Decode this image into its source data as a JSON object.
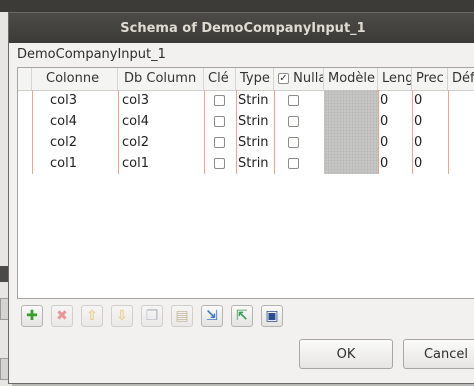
{
  "window": {
    "title": "Schema of DemoCompanyInput_1"
  },
  "schema": {
    "name": "DemoCompanyInput_1"
  },
  "table": {
    "columns": [
      "Colonne",
      "Db Column",
      "Clé",
      "Type",
      "Nulla",
      "Modèle",
      "Leng",
      "Prec",
      "Déf"
    ],
    "nullable_header_checked": true,
    "rows": [
      {
        "colonne": "col3",
        "db_column": "col3",
        "type": "Strin",
        "length": "0",
        "precision": "0"
      },
      {
        "colonne": "col4",
        "db_column": "col4",
        "type": "Strin",
        "length": "0",
        "precision": "0"
      },
      {
        "colonne": "col2",
        "db_column": "col2",
        "type": "Strin",
        "length": "0",
        "precision": "0"
      },
      {
        "colonne": "col1",
        "db_column": "col1",
        "type": "Strin",
        "length": "0",
        "precision": "0"
      }
    ]
  },
  "toolbar": {
    "icons": [
      "add-icon",
      "remove-icon",
      "move-up-icon",
      "move-down-icon",
      "copy-icon",
      "paste-icon",
      "import-icon",
      "export-icon",
      "save-icon"
    ]
  },
  "buttons": {
    "ok": "OK",
    "cancel": "Cancel"
  },
  "colors": {
    "titlebar": "#3c3b37",
    "grid_line": "#f2a38c",
    "add": "#3a9b2e",
    "remove": "#d9534f"
  }
}
